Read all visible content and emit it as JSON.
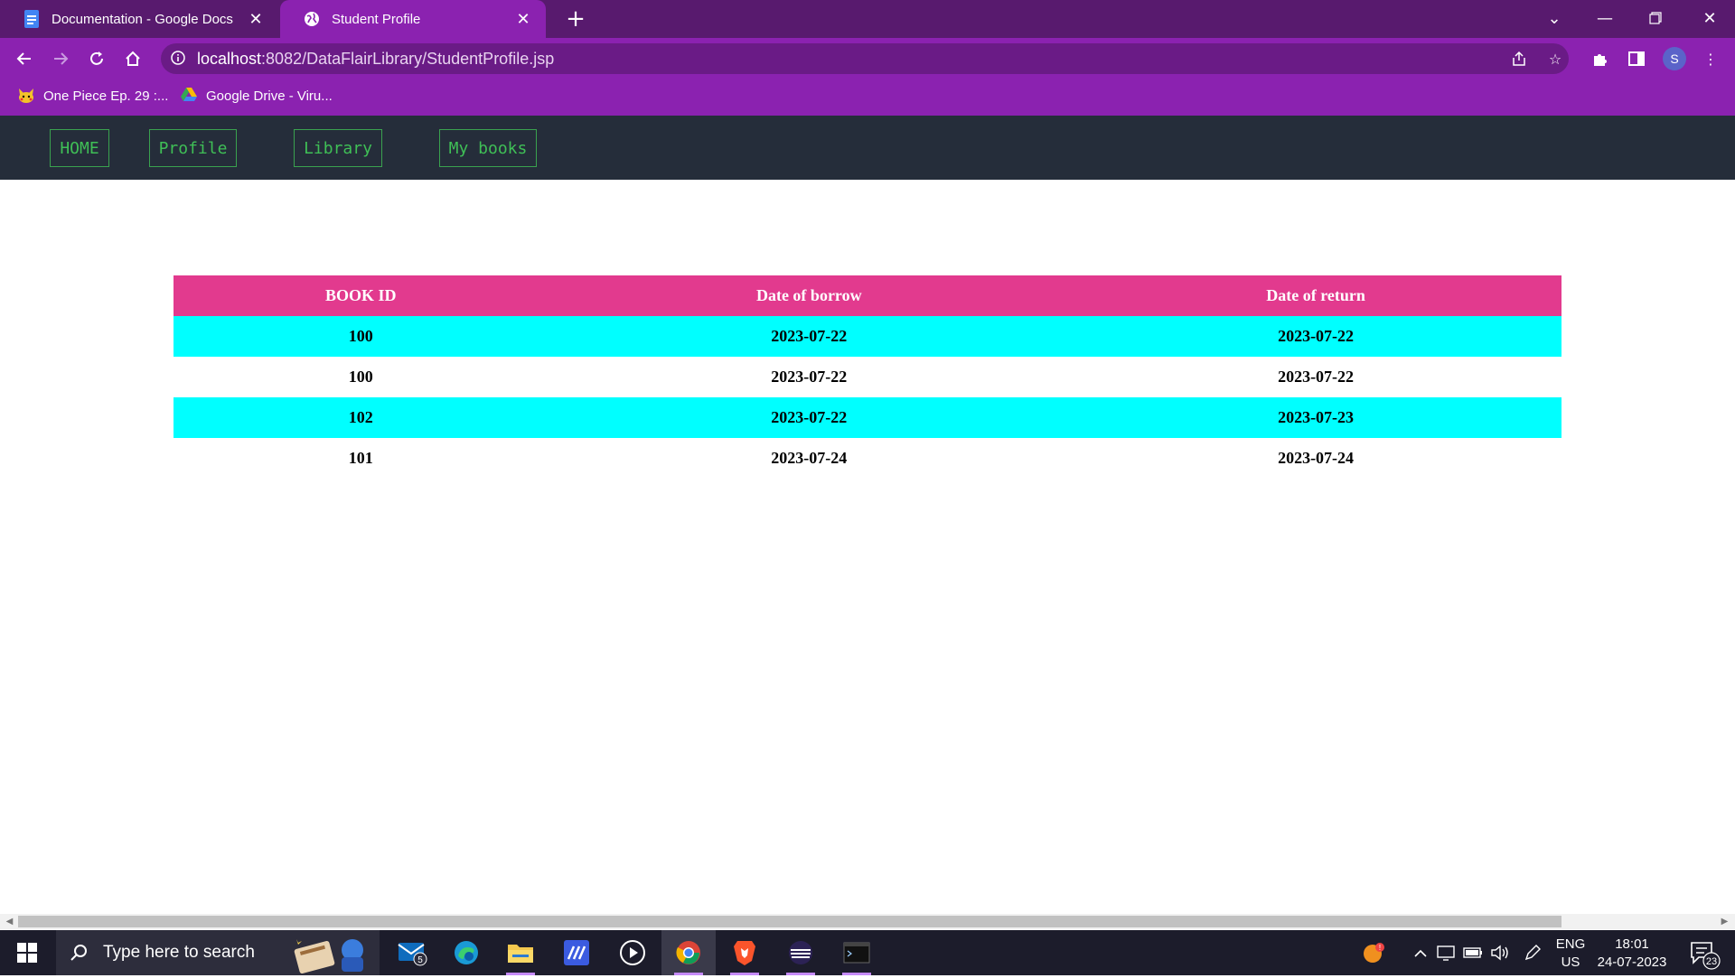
{
  "browser": {
    "tabs": [
      {
        "title": "Documentation - Google Docs",
        "active": false
      },
      {
        "title": "Student Profile",
        "active": true
      }
    ],
    "url_host": "localhost",
    "url_rest": ":8082/DataFlairLibrary/StudentProfile.jsp",
    "avatar_letter": "S",
    "bookmarks": [
      {
        "label": "One Piece Ep. 29 :..."
      },
      {
        "label": "Google Drive - Viru..."
      }
    ]
  },
  "site_nav": {
    "items": [
      {
        "label": "HOME"
      },
      {
        "label": "Profile"
      },
      {
        "label": "Library"
      },
      {
        "label": "My books"
      }
    ]
  },
  "borrow_table": {
    "headers": [
      "BOOK ID",
      "Date of borrow",
      "Date of return"
    ],
    "rows": [
      [
        "100",
        "2023-07-22",
        "2023-07-22"
      ],
      [
        "100",
        "2023-07-22",
        "2023-07-22"
      ],
      [
        "102",
        "2023-07-22",
        "2023-07-23"
      ],
      [
        "101",
        "2023-07-24",
        "2023-07-24"
      ]
    ]
  },
  "taskbar": {
    "search_placeholder": "Type here to search",
    "mail_badge": "5",
    "lang_line1": "ENG",
    "lang_line2": "US",
    "time": "18:01",
    "date": "24-07-2023",
    "notification_count": "23"
  },
  "colors": {
    "tabbar": "#581a6e",
    "toolbar": "#8b22b0",
    "site_nav_bg": "#252d3a",
    "nav_link": "#3fbf56",
    "table_header": "#e23a8e",
    "row_highlight": "#00ffff"
  }
}
